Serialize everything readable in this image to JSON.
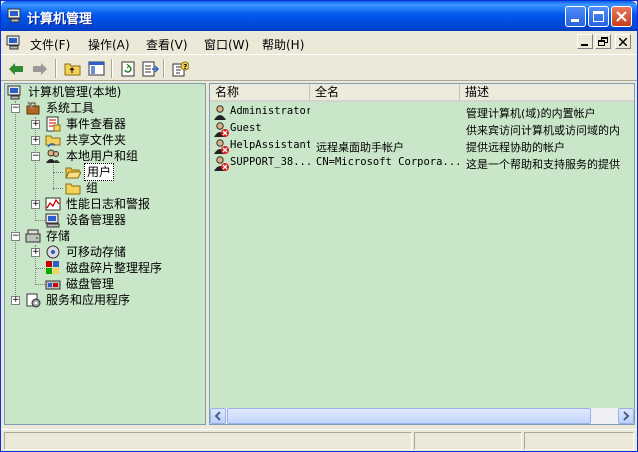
{
  "window": {
    "title": "计算机管理"
  },
  "menu": {
    "items": [
      "文件(F)",
      "操作(A)",
      "查看(V)",
      "窗口(W)",
      "帮助(H)"
    ]
  },
  "toolbar": {
    "icons": [
      "back-arrow-icon",
      "forward-arrow-icon",
      "up-folder-icon",
      "show-hide-tree-icon",
      "refresh-icon",
      "export-list-icon",
      "help-icon"
    ]
  },
  "tree": {
    "root": "计算机管理(本地)",
    "system_tools": "系统工具",
    "event_viewer": "事件查看器",
    "shared_folders": "共享文件夹",
    "local_users": "本地用户和组",
    "users": "用户",
    "groups": "组",
    "perf_logs": "性能日志和警报",
    "device_manager": "设备管理器",
    "storage": "存储",
    "removable": "可移动存储",
    "defrag": "磁盘碎片整理程序",
    "disk_mgmt": "磁盘管理",
    "services": "服务和应用程序"
  },
  "list": {
    "columns": [
      "名称",
      "全名",
      "描述"
    ],
    "rows": [
      {
        "name": "Administrator",
        "fullname": "",
        "description": "管理计算机(域)的内置帐户",
        "disabled": false
      },
      {
        "name": "Guest",
        "fullname": "",
        "description": "供来宾访问计算机或访问域的内",
        "disabled": true
      },
      {
        "name": "HelpAssistant",
        "fullname": "远程桌面助手帐户",
        "description": "提供远程协助的帐户",
        "disabled": true
      },
      {
        "name": "SUPPORT_38...",
        "fullname": "CN=Microsoft Corpora...",
        "description": "这是一个帮助和支持服务的提供",
        "disabled": true
      }
    ]
  },
  "colors": {
    "pane_background": "#c9e6c9",
    "title_bar": "#0058ee",
    "window_bg": "#ece9d8"
  }
}
